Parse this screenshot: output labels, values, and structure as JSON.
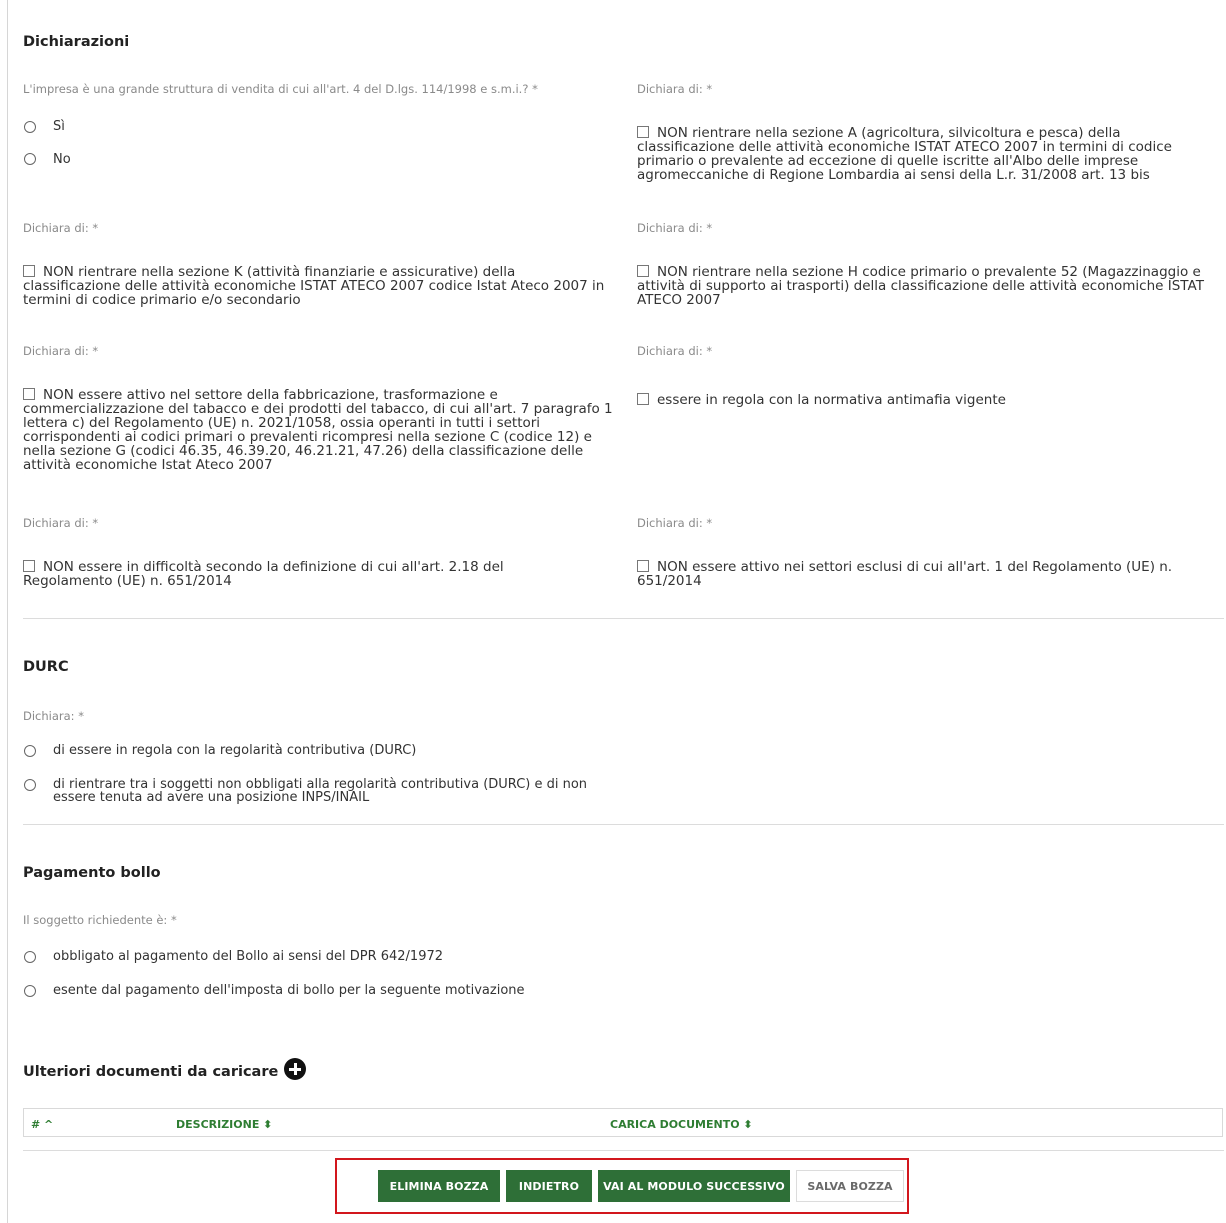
{
  "dichiarazioni": {
    "title": "Dichiarazioni",
    "grande_struttura": {
      "label": "L'impresa è una grande struttura di vendita di cui all'art. 4 del D.lgs. 114/1998 e s.m.i.? *",
      "options": [
        "Sì",
        "No"
      ]
    },
    "dichiara_label": "Dichiara di: *",
    "sezione_a": "NON rientrare nella sezione A (agricoltura, silvicoltura e pesca) della classificazione delle attività economiche ISTAT ATECO 2007 in termini di codice primario o prevalente ad eccezione di quelle iscritte all'Albo delle imprese agromeccaniche di Regione Lombardia ai sensi della L.r. 31/2008 art. 13 bis",
    "sezione_k": "NON rientrare nella sezione K (attività finanziarie e assicurative) della classificazione delle attività economiche ISTAT ATECO 2007 codice Istat Ateco 2007 in termini di codice primario e/o secondario",
    "sezione_h": "NON rientrare nella sezione H codice primario o prevalente 52 (Magazzinaggio e attività di supporto ai trasporti) della classificazione delle attività economiche ISTAT ATECO 2007",
    "tabacco": "NON essere attivo nel settore della fabbricazione, trasformazione e commercializzazione del tabacco e dei prodotti del tabacco, di cui all'art. 7 paragrafo 1 lettera c) del Regolamento (UE) n. 2021/1058, ossia operanti in tutti i settori corrispondenti ai codici primari o prevalenti ricompresi nella sezione C (codice 12) e nella sezione G (codici 46.35, 46.39.20, 46.21.21, 47.26) della classificazione delle attività economiche Istat Ateco 2007",
    "antimafia": "essere in regola con la normativa antimafia vigente",
    "difficolta": "NON essere in difficoltà secondo la definizione di cui all'art. 2.18 del Regolamento (UE) n. 651/2014",
    "settori_esclusi": "NON essere attivo nei settori esclusi di cui all'art. 1 del Regolamento (UE) n. 651/2014"
  },
  "durc": {
    "title": "DURC",
    "label": "Dichiara: *",
    "options": [
      "di essere in regola con la regolarità contributiva (DURC)",
      "di rientrare tra i soggetti non obbligati alla regolarità contributiva (DURC) e di non essere tenuta ad avere una posizione INPS/INAIL"
    ]
  },
  "bollo": {
    "title": "Pagamento bollo",
    "label": "Il soggetto richiedente è: *",
    "options": [
      "obbligato al pagamento del Bollo ai sensi del DPR 642/1972",
      "esente dal pagamento dell'imposta di bollo per la seguente motivazione"
    ]
  },
  "documenti": {
    "title": "Ulteriori documenti da caricare",
    "add_icon": "plus-circle-icon",
    "columns": [
      "# ^",
      "DESCRIZIONE ⬍",
      "CARICA DOCUMENTO ⬍"
    ]
  },
  "actions": {
    "elimina": "ELIMINA BOZZA",
    "indietro": "INDIETRO",
    "successivo": "VAI AL MODULO SUCCESSIVO",
    "salva": "SALVA BOZZA"
  },
  "colors": {
    "primary": "#2e6f37",
    "highlight": "#d2171d"
  }
}
